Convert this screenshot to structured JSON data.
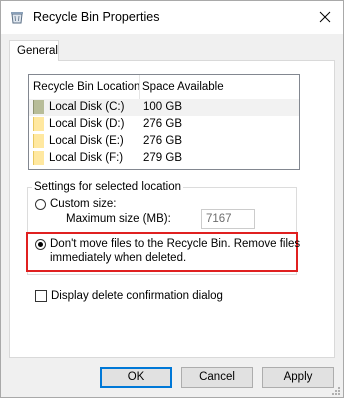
{
  "window": {
    "title": "Recycle Bin Properties",
    "close_icon": "close-icon",
    "title_icon": "recycle-bin-icon"
  },
  "tabs": [
    {
      "label": "General",
      "active": true
    }
  ],
  "list": {
    "columns": [
      "Recycle Bin Location",
      "Space Available"
    ],
    "rows": [
      {
        "location": "Local Disk (C:)",
        "space": "100 GB",
        "selected": true
      },
      {
        "location": "Local Disk (D:)",
        "space": "276 GB",
        "selected": false
      },
      {
        "location": "Local Disk (E:)",
        "space": "276 GB",
        "selected": false
      },
      {
        "location": "Local Disk (F:)",
        "space": "279 GB",
        "selected": false
      }
    ]
  },
  "settings": {
    "group_label": "Settings for selected location",
    "custom_size_label": "Custom size:",
    "custom_size_selected": false,
    "max_size_label": "Maximum size (MB):",
    "max_size_value": "7167",
    "dont_move_line1": "Don't move files to the Recycle Bin. Remove files",
    "dont_move_line2": "immediately when deleted.",
    "dont_move_selected": true,
    "highlight_color": "#e02020"
  },
  "confirm": {
    "label": "Display delete confirmation dialog",
    "checked": false
  },
  "buttons": {
    "ok": "OK",
    "cancel": "Cancel",
    "apply": "Apply"
  },
  "colors": {
    "accent": "#0078d7",
    "drive_icon": "#ffe8a0",
    "system_drive_icon": "#b7bc98"
  }
}
